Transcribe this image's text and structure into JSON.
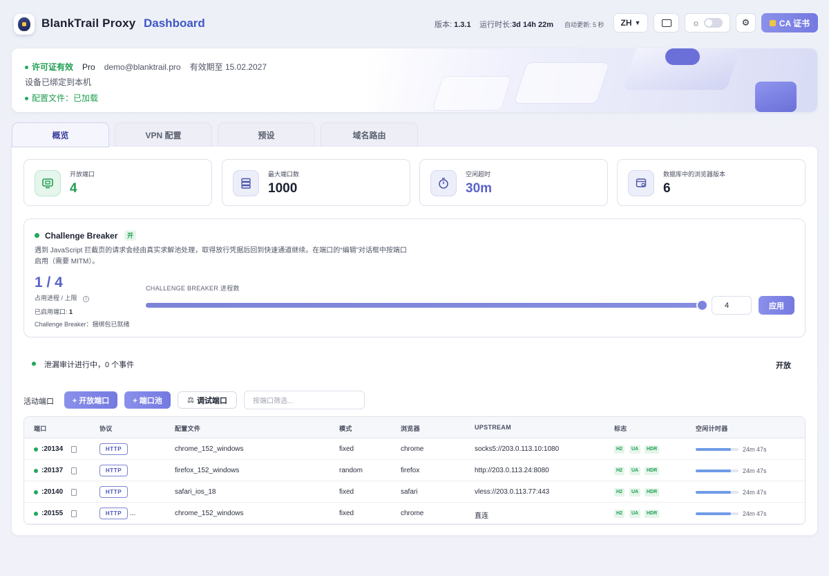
{
  "header": {
    "app_name": "BlankTrail Proxy",
    "app_section": "Dashboard",
    "version_label": "版本:",
    "version": "1.3.1",
    "uptime_label": "运行时长:",
    "uptime": "3d 14h 22m",
    "autorefresh_label": "自动更新:",
    "autorefresh": "5 秒",
    "language": "ZH",
    "ca_button": "CA 证书"
  },
  "license": {
    "status": "许可证有效",
    "plan": "Pro",
    "email": "demo@blanktrail.pro",
    "expiry": "有效期至 15.02.2027",
    "device": "设备已绑定到本机",
    "config": "配置文件：已加载"
  },
  "tabs": [
    {
      "label": "概览",
      "active": true
    },
    {
      "label": "VPN 配置",
      "active": false
    },
    {
      "label": "预设",
      "active": false
    },
    {
      "label": "域名路由",
      "active": false
    }
  ],
  "stats": [
    {
      "label": "开放端口",
      "value": "4",
      "icon": "monitor-icon",
      "color": "#1e9e50"
    },
    {
      "label": "最大端口数",
      "value": "1000",
      "icon": "server-icon",
      "color": "#1b2030"
    },
    {
      "label": "空闲超时",
      "value": "30m",
      "icon": "stopwatch-icon",
      "color": "#5a62c8"
    },
    {
      "label": "数据库中的浏览器版本",
      "value": "6",
      "icon": "browser-icon",
      "color": "#1b2030"
    }
  ],
  "challenge_breaker": {
    "title": "Challenge Breaker",
    "badge": "开",
    "description": "遇到 JavaScript 拦截页的请求会经由真实求解池处理，取得放行凭据后回到快速通道继续。在端口的“编辑”对话框中按端口启用（需要 MITM）。",
    "ratio": "1 / 4",
    "ratio_label": "占用进程 / 上限",
    "enabled_ports": "已启用端口:",
    "enabled_ports_value": "1",
    "status": "Challenge Breaker：捆绑包已就绪",
    "slider_label": "CHALLENGE BREAKER 进程数",
    "slider_value": 4,
    "slider_max": 4,
    "apply": "应用"
  },
  "leak_audit": {
    "text": "泄漏审计进行中，0 个事件",
    "action": "开放"
  },
  "ports_toolbar": {
    "label": "活动端口",
    "open_port": "+ 开放端口",
    "port_pool": "+ 端口池",
    "debug_port": "调试端口",
    "filter_placeholder": "按端口筛选..."
  },
  "table": {
    "columns": [
      "端口",
      "协议",
      "配置文件",
      "模式",
      "浏览器",
      "UPSTREAM",
      "标志",
      "空闲计时器"
    ],
    "rows": [
      {
        "port": ":20134",
        "protocol": "HTTP",
        "extra": "",
        "profile": "chrome_152_windows",
        "mode": "fixed",
        "browser": "chrome",
        "upstream": "socks5://203.0.113.10:1080",
        "flags": [
          "H2",
          "UA",
          "HDR"
        ],
        "idle": "24m 47s",
        "idle_fraction": 0.83
      },
      {
        "port": ":20137",
        "protocol": "HTTP",
        "extra": "",
        "profile": "firefox_152_windows",
        "mode": "random",
        "browser": "firefox",
        "upstream": "http://203.0.113.24:8080",
        "flags": [
          "H2",
          "UA",
          "HDR"
        ],
        "idle": "24m 47s",
        "idle_fraction": 0.83
      },
      {
        "port": ":20140",
        "protocol": "HTTP",
        "extra": "",
        "profile": "safari_ios_18",
        "mode": "fixed",
        "browser": "safari",
        "upstream": "vless://203.0.113.77:443",
        "flags": [
          "H2",
          "UA",
          "HDR"
        ],
        "idle": "24m 47s",
        "idle_fraction": 0.83
      },
      {
        "port": ":20155",
        "protocol": "HTTP",
        "extra": "...",
        "profile": "chrome_152_windows",
        "mode": "fixed",
        "browser": "chrome",
        "upstream": "直连",
        "flags": [
          "H2",
          "UA",
          "HDR"
        ],
        "idle": "24m 47s",
        "idle_fraction": 0.83
      }
    ]
  }
}
